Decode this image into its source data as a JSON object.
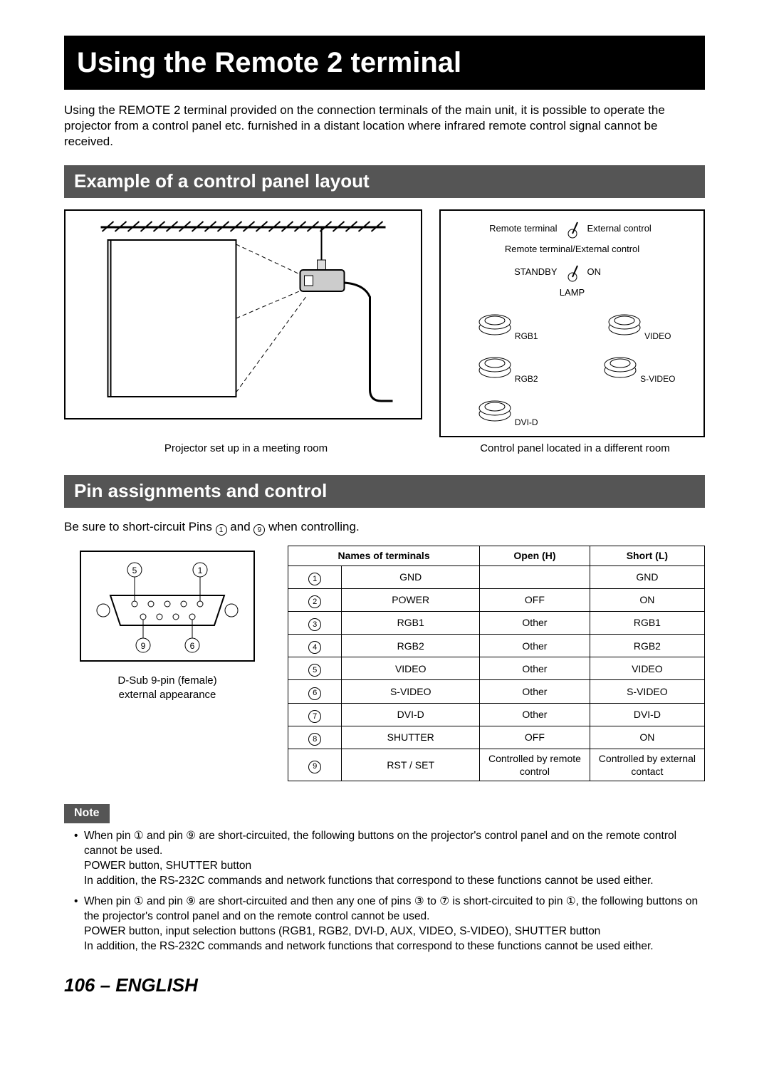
{
  "title": "Using the Remote 2 terminal",
  "intro": "Using the REMOTE 2 terminal provided on the connection terminals of the main unit, it is possible to operate the projector from a control panel etc. furnished in a distant location where infrared remote control signal cannot be received.",
  "section1": "Example of a control panel layout",
  "caption_left": "Projector set up in a meeting room",
  "caption_right": "Control panel located in a different room",
  "panel": {
    "remote_terminal": "Remote terminal",
    "external_control": "External control",
    "combined": "Remote terminal/External control",
    "standby": "STANDBY",
    "on": "ON",
    "lamp": "LAMP",
    "rgb1": "RGB1",
    "video": "VIDEO",
    "rgb2": "RGB2",
    "svideo": "S-VIDEO",
    "dvid": "DVI-D"
  },
  "section2": "Pin assignments and control",
  "short_note_a": "Be sure to short-circuit Pins ",
  "short_note_b": " and ",
  "short_note_c": " when controlling.",
  "fig_line1": "D-Sub 9-pin (female)",
  "fig_line2": "external appearance",
  "table": {
    "h_names": "Names of terminals",
    "h_open": "Open (H)",
    "h_short": "Short (L)",
    "rows": [
      {
        "n": "1",
        "name": "GND",
        "open": "",
        "short": "GND"
      },
      {
        "n": "2",
        "name": "POWER",
        "open": "OFF",
        "short": "ON"
      },
      {
        "n": "3",
        "name": "RGB1",
        "open": "Other",
        "short": "RGB1"
      },
      {
        "n": "4",
        "name": "RGB2",
        "open": "Other",
        "short": "RGB2"
      },
      {
        "n": "5",
        "name": "VIDEO",
        "open": "Other",
        "short": "VIDEO"
      },
      {
        "n": "6",
        "name": "S-VIDEO",
        "open": "Other",
        "short": "S-VIDEO"
      },
      {
        "n": "7",
        "name": "DVI-D",
        "open": "Other",
        "short": "DVI-D"
      },
      {
        "n": "8",
        "name": "SHUTTER",
        "open": "OFF",
        "short": "ON"
      },
      {
        "n": "9",
        "name": "RST / SET",
        "open": "Controlled by remote control",
        "short": "Controlled by external contact"
      }
    ]
  },
  "note_label": "Note",
  "notes": {
    "n1": {
      "p": "When pin ① and pin ⑨ are short-circuited, the following buttons on the projector's control panel and on the remote control cannot be used.\nPOWER button, SHUTTER button\nIn addition, the RS-232C commands and network functions that correspond to these functions cannot be used either."
    },
    "n2": {
      "p": "When pin ① and pin ⑨ are short-circuited and then any one of pins ③ to ⑦ is short-circuited to pin ①, the following buttons on the projector's control panel and on the remote control cannot be used.\nPOWER button, input selection buttons (RGB1, RGB2, DVI-D, AUX, VIDEO, S-VIDEO), SHUTTER button\nIn addition, the RS-232C commands and network functions that correspond to these functions cannot be used either."
    }
  },
  "footer": "106 – ENGLISH"
}
